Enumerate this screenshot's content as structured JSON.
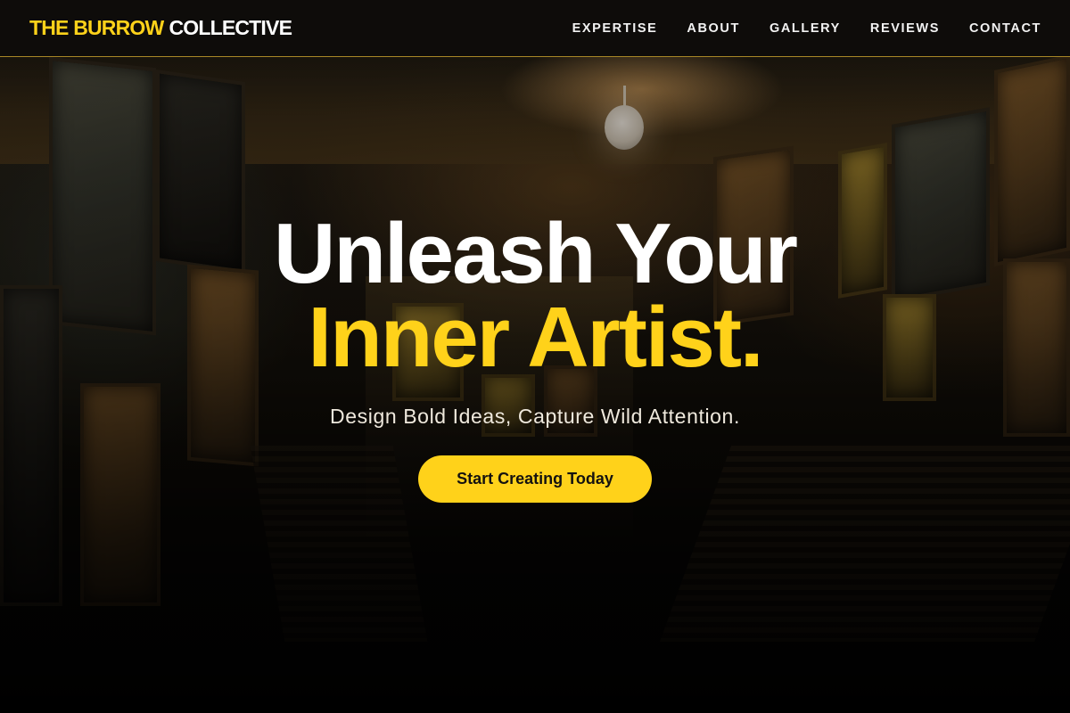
{
  "brand": {
    "accent": "THE BURROW",
    "main": "COLLECTIVE"
  },
  "nav": {
    "items": [
      "EXPERTISE",
      "ABOUT",
      "GALLERY",
      "REVIEWS",
      "CONTACT"
    ]
  },
  "hero": {
    "headline_line1": "Unleash Your",
    "headline_line2": "Inner Artist.",
    "subheadline": "Design Bold Ideas, Capture Wild Attention.",
    "cta_label": "Start Creating Today"
  },
  "colors": {
    "accent": "#ffd21a",
    "nav_background": "#0e0c0a",
    "nav_border": "#a88726",
    "headline_primary": "#ffffff",
    "cta_text": "#141210"
  },
  "icons": []
}
